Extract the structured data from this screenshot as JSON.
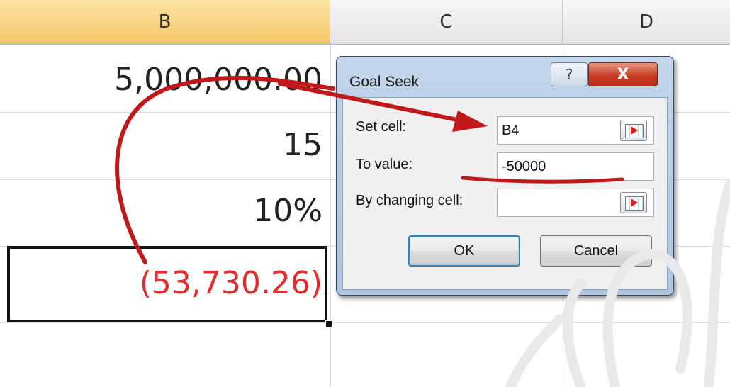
{
  "columns": [
    "B",
    "C",
    "D"
  ],
  "cells": {
    "b1": "5,000,000.00",
    "b2": "15",
    "b3": "10%",
    "b4": "(53,730.26)"
  },
  "dialog": {
    "title": "Goal Seek",
    "help_glyph": "?",
    "close_glyph": "X",
    "set_cell_label": "Set cell:",
    "to_value_label": "To value:",
    "changing_cell_label": "By changing cell:",
    "set_cell_value": "B4",
    "to_value": "-50000",
    "changing_cell_value": "",
    "ok_label": "OK",
    "cancel_label": "Cancel"
  },
  "colors": {
    "selected_header": "#f6c76a",
    "negative_value": "#e52b2b",
    "annotation_arrow": "#c0181b"
  },
  "icons": [
    "range-select-icon",
    "help-icon",
    "close-icon"
  ]
}
